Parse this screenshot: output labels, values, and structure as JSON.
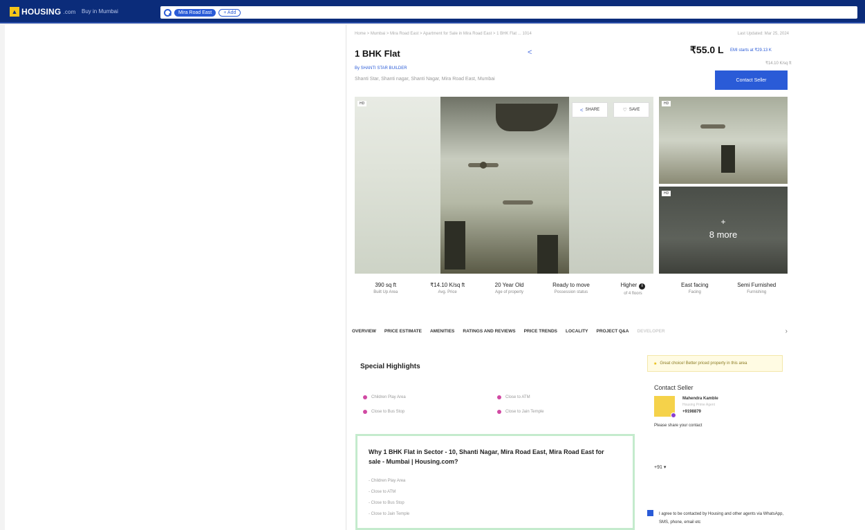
{
  "header": {
    "logo_text": "HOUSING",
    "logo_suffix": ".com",
    "city": "Buy in Mumbai",
    "search_chip": "Mira Road East",
    "add_chip": "+ Add"
  },
  "listing": {
    "breadcrumb": "Home > Mumbai > Mira Road East > Apartment for Sale in Mira Road East > 1 BHK Flat ... 1014",
    "last_updated": "Last Updated: Mar 25, 2024",
    "title": "1 BHK Flat",
    "builder": "By SHANTI STAR BUILDER",
    "address": "Shanti Star, Shanti nagar, Shanti Nagar, Mira Road East, Mumbai",
    "price": "₹55.0 L",
    "emi": "EMI starts at ₹29.13 K",
    "price_per_sqft": "₹14.10 K/sq ft",
    "contact_button": "Contact Seller",
    "share_icon": "share-icon"
  },
  "gallery": {
    "hd_tag": "HD",
    "share_label": "SHARE",
    "save_label": "SAVE",
    "more_plus": "+",
    "more_label": "8 more"
  },
  "stats": [
    {
      "value": "390 sq ft",
      "label": "Built Up Area"
    },
    {
      "value": "₹14.10 K/sq ft",
      "label": "Avg. Price"
    },
    {
      "value": "20 Year Old",
      "label": "Age of property"
    },
    {
      "value": "Ready to move",
      "label": "Possession status"
    },
    {
      "value": "Higher",
      "label": "of 4 floors"
    },
    {
      "value": "East facing",
      "label": "Facing"
    },
    {
      "value": "Semi Furnished",
      "label": "Furnishing"
    }
  ],
  "tabs": [
    "OVERVIEW",
    "PRICE ESTIMATE",
    "AMENITIES",
    "RATINGS AND REVIEWS",
    "PRICE TRENDS",
    "LOCALITY",
    "PROJECT Q&A",
    "DEVELOPER"
  ],
  "highlights": {
    "title": "Special Highlights",
    "items": [
      "Children Play Area",
      "Close to ATM",
      "Close to Bus Stop",
      "Close to Jain Temple"
    ]
  },
  "why": {
    "title": "Why 1 BHK Flat in Sector - 10, Shanti Nagar, Mira Road East, Mira Road East for sale - Mumbai | Housing.com?",
    "items": [
      "Children Play Area",
      "Close to ATM",
      "Close to Bus Stop",
      "Close to Jain Temple"
    ]
  },
  "seller": {
    "great_choice": "Great choice! Better priced property in this area",
    "title": "Contact Seller",
    "name": "Mahendra Kamble",
    "role": "Housing Prime Agent",
    "phone": "+9198879",
    "share_prompt": "Please share your contact",
    "country_code": "+91 ▾",
    "agree_text": "I agree to be contacted by Housing and other agents via WhatsApp, SMS, phone, email etc"
  },
  "colors": {
    "brand_navy": "#0b2c7a",
    "accent_blue": "#2a5bd7",
    "highlight_dot": "#d14aa3",
    "why_border": "#c4ebcd"
  }
}
